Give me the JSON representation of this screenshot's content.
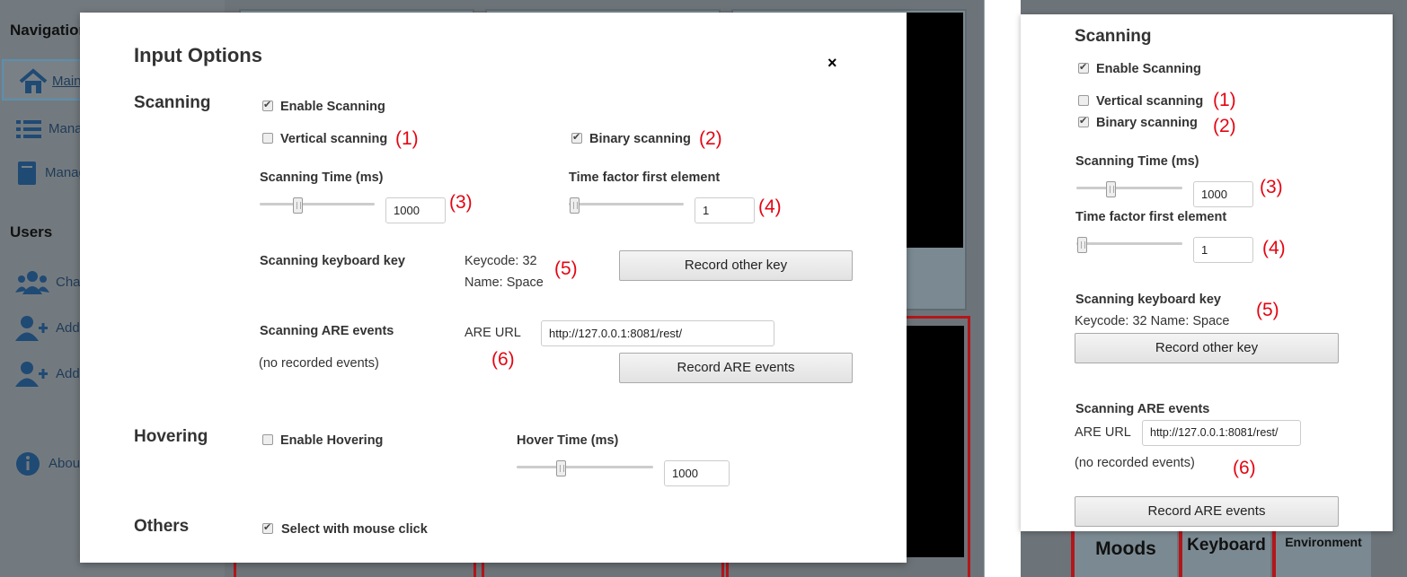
{
  "desktop": {
    "nav": {
      "title": "Navigation",
      "items": [
        {
          "label": "Main",
          "icon": "home-icon"
        },
        {
          "label": "Manage",
          "icon": "list-icon"
        },
        {
          "label": "Manage",
          "icon": "book-icon"
        }
      ],
      "users_title": "Users",
      "user_items": [
        {
          "label": "Change",
          "icon": "users-icon"
        },
        {
          "label": "Add",
          "icon": "add-user-icon"
        },
        {
          "label": "Add",
          "icon": "add-user-icon"
        }
      ],
      "about": {
        "label": "About",
        "icon": "info-icon"
      }
    },
    "modal": {
      "title": "Input Options",
      "close": "×",
      "scanning": {
        "title": "Scanning",
        "enable_label": "Enable Scanning",
        "enable_checked": true,
        "vertical_label": "Vertical scanning",
        "vertical_checked": false,
        "binary_label": "Binary scanning",
        "binary_checked": true,
        "time_label": "Scanning Time (ms)",
        "time_value": "1000",
        "time_slider_fraction": 0.3,
        "factor_label": "Time factor first element",
        "factor_value": "1",
        "factor_slider_fraction": 0.0,
        "key_label": "Scanning keyboard key",
        "keycode": "Keycode: 32",
        "keyname": "Name: Space",
        "record_key_button": "Record other key",
        "are_label": "Scanning ARE events",
        "no_events": "(no recorded events)",
        "are_url_label": "ARE URL",
        "are_url_value": "http://127.0.0.1:8081/rest/",
        "record_are_button": "Record ARE events"
      },
      "hovering": {
        "title": "Hovering",
        "enable_label": "Enable Hovering",
        "enable_checked": false,
        "time_label": "Hover Time (ms)",
        "time_value": "1000",
        "time_slider_fraction": 0.3
      },
      "others": {
        "title": "Others",
        "mouse_label": "Select with mouse click",
        "mouse_checked": true
      }
    }
  },
  "mobile": {
    "title": "Scanning",
    "enable_label": "Enable Scanning",
    "vertical_label": "Vertical scanning",
    "binary_label": "Binary scanning",
    "time_label": "Scanning Time (ms)",
    "time_value": "1000",
    "factor_label": "Time factor first element",
    "factor_value": "1",
    "key_label": "Scanning keyboard key",
    "key_info": "Keycode: 32 Name: Space",
    "record_key_button": "Record other key",
    "are_label": "Scanning ARE events",
    "are_url_label": "ARE URL",
    "are_url_value": "http://127.0.0.1:8081/rest/",
    "no_events": "(no recorded events)",
    "record_are_button": "Record ARE events",
    "tiles": [
      "Moods",
      "Keyboard",
      "Environment"
    ]
  },
  "annotations": [
    "(1)",
    "(2)",
    "(3)",
    "(4)",
    "(5)",
    "(6)"
  ],
  "colors": {
    "annotation": "#e30613",
    "background_app": "#6d7479",
    "tile_border": "#b2161b"
  }
}
